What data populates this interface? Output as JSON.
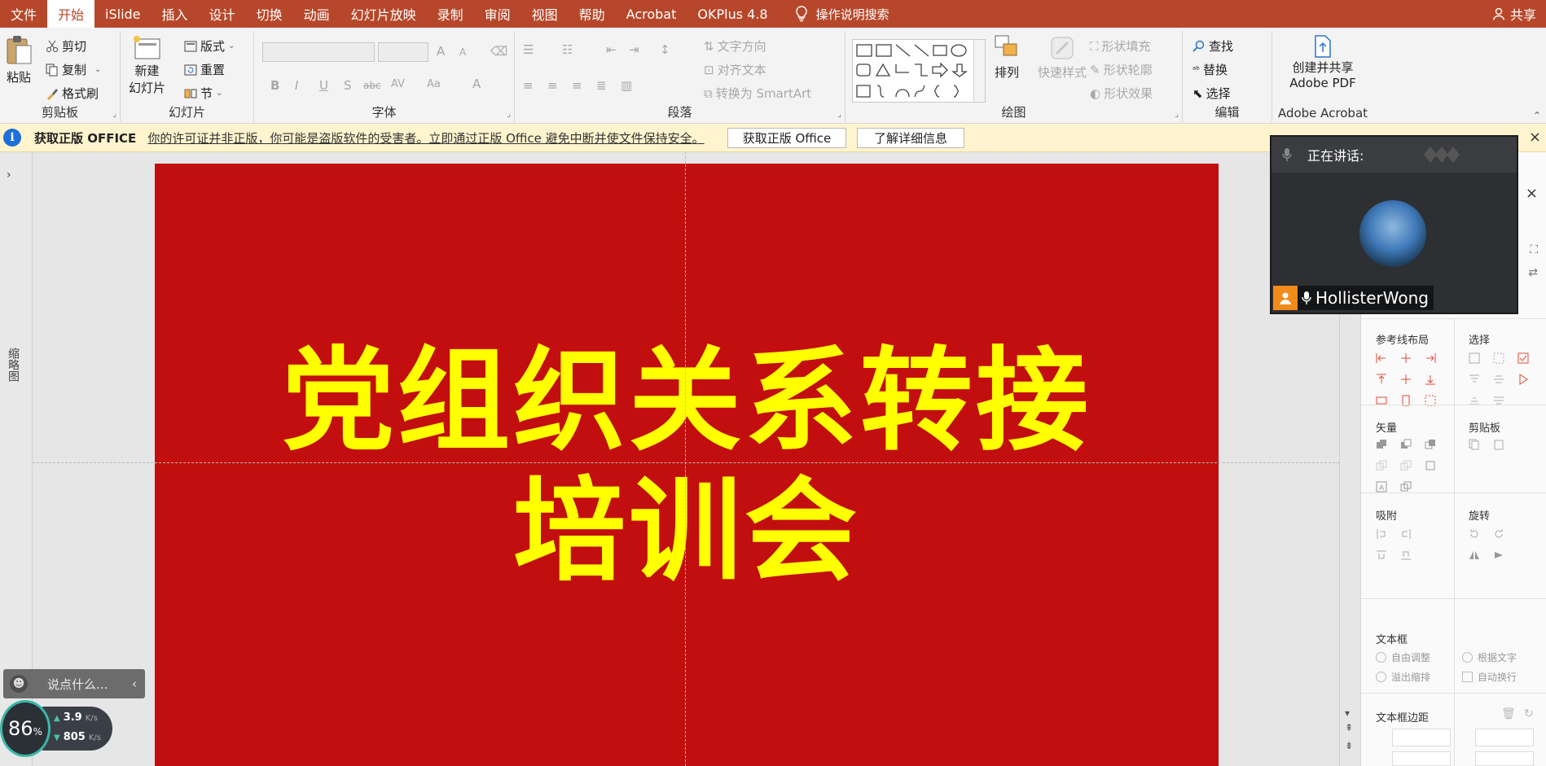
{
  "menubar": {
    "tabs": [
      "文件",
      "开始",
      "iSlide",
      "插入",
      "设计",
      "切换",
      "动画",
      "幻灯片放映",
      "录制",
      "审阅",
      "视图",
      "帮助",
      "Acrobat",
      "OKPlus 4.8"
    ],
    "active_tab": "开始",
    "tellme": "操作说明搜索",
    "share": "共享",
    "color": "#b7472a"
  },
  "ribbon": {
    "clipboard": {
      "paste": "粘贴",
      "cut": "剪切",
      "copy": "复制",
      "format_painter": "格式刷",
      "label": "剪贴板"
    },
    "slides": {
      "new_slide_1": "新建",
      "new_slide_2": "幻灯片",
      "layout": "版式",
      "reset": "重置",
      "section": "节",
      "label": "幻灯片"
    },
    "font": {
      "label": "字体",
      "bold": "B",
      "italic": "I",
      "underline": "U",
      "shadow": "S",
      "strike": "abc",
      "spacing": "AV",
      "case": "Aa",
      "color": "A",
      "grow": "A",
      "shrink": "A"
    },
    "paragraph": {
      "text_direction": "文字方向",
      "align_text": "对齐文本",
      "smartart": "转换为 SmartArt",
      "label": "段落"
    },
    "drawing": {
      "arrange": "排列",
      "quick_styles": "快速样式",
      "shape_fill": "形状填充",
      "shape_outline": "形状轮廓",
      "shape_effects": "形状效果",
      "label": "绘图"
    },
    "editing": {
      "find": "查找",
      "replace": "替换",
      "select": "选择",
      "label": "编辑"
    },
    "acrobat": {
      "create_share_1": "创建并共享",
      "create_share_2": "Adobe PDF",
      "label": "Adobe Acrobat"
    }
  },
  "notification": {
    "title": "获取正版 OFFICE",
    "message": "你的许可证并非正版，你可能是盗版软件的受害者。立即通过正版 Office 避免中断并使文件保持安全。",
    "btn_get": "获取正版 Office",
    "btn_learn": "了解详细信息",
    "info_glyph": "i",
    "close_glyph": "×"
  },
  "thumbnail_pane": {
    "label": "缩略图",
    "expand_glyph": "›"
  },
  "slide": {
    "title_line1": "党组织关系转接",
    "title_line2": "培训会",
    "background": "#c20e0e",
    "text_color": "#ffff00"
  },
  "right_panel": {
    "guide_layout": "参考线布局",
    "select": "选择",
    "vector": "矢量",
    "clipboard": "剪贴板",
    "snap": "吸附",
    "rotate": "旋转",
    "textbox": "文本框",
    "auto_adjust": "自由调整",
    "fit_text": "根据文字",
    "overflow_shrink": "溢出缩排",
    "auto_wrap": "自动换行",
    "textbox_margin": "文本框边距",
    "close_glyph": "×"
  },
  "meeting": {
    "speaking_label": "正在讲话:",
    "username": "HollisterWong"
  },
  "chat": {
    "placeholder": "说点什么...",
    "collapse_glyph": "‹"
  },
  "netmon": {
    "percent": "86",
    "percent_unit": "%",
    "upload": "3.9",
    "download": "805",
    "unit": "K/s"
  },
  "colors": {
    "accent": "#b7472a",
    "icon_red": "#e04a3a"
  }
}
